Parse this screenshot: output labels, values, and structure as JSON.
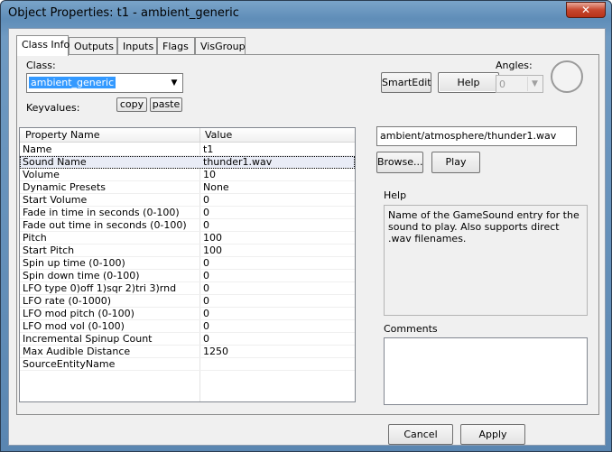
{
  "window": {
    "title": "Object Properties: t1 - ambient_generic",
    "close_label": "✕"
  },
  "tabs": [
    {
      "label": "Class Info",
      "active": true
    },
    {
      "label": "Outputs"
    },
    {
      "label": "Inputs"
    },
    {
      "label": "Flags"
    },
    {
      "label": "VisGroup"
    }
  ],
  "class_info": {
    "class_label": "Class:",
    "class_value": "ambient_generic",
    "smartedit_label": "SmartEdit",
    "help_label": "Help",
    "angles_label": "Angles:",
    "angles_value": "0",
    "keyvalues_label": "Keyvalues:",
    "copy_label": "copy",
    "paste_label": "paste"
  },
  "table": {
    "col_name": "Property Name",
    "col_value": "Value",
    "rows": [
      {
        "name": "Name",
        "value": "t1"
      },
      {
        "name": "Sound Name",
        "value": "thunder1.wav"
      },
      {
        "name": "Volume",
        "value": "10"
      },
      {
        "name": "Dynamic Presets",
        "value": "None"
      },
      {
        "name": "Start Volume",
        "value": "0"
      },
      {
        "name": "Fade in time in seconds (0-100)",
        "value": "0"
      },
      {
        "name": "Fade out time in seconds (0-100)",
        "value": "0"
      },
      {
        "name": "Pitch",
        "value": "100"
      },
      {
        "name": "Start Pitch",
        "value": "100"
      },
      {
        "name": "Spin up time (0-100)",
        "value": "0"
      },
      {
        "name": "Spin down time (0-100)",
        "value": "0"
      },
      {
        "name": "LFO type 0)off 1)sqr 2)tri 3)rnd",
        "value": "0"
      },
      {
        "name": "LFO rate (0-1000)",
        "value": "0"
      },
      {
        "name": "LFO mod pitch (0-100)",
        "value": "0"
      },
      {
        "name": "LFO mod vol (0-100)",
        "value": "0"
      },
      {
        "name": "Incremental Spinup Count",
        "value": "0"
      },
      {
        "name": "Max Audible Distance",
        "value": "1250"
      },
      {
        "name": "SourceEntityName",
        "value": ""
      }
    ]
  },
  "editor": {
    "sound_path": "ambient/atmosphere/thunder1.wav",
    "browse_label": "Browse...",
    "play_label": "Play",
    "help_heading": "Help",
    "help_text": "Name of the GameSound entry for the sound to play. Also supports direct .wav filenames.",
    "comments_heading": "Comments",
    "comments_value": ""
  },
  "footer": {
    "cancel_label": "Cancel",
    "apply_label": "Apply"
  }
}
